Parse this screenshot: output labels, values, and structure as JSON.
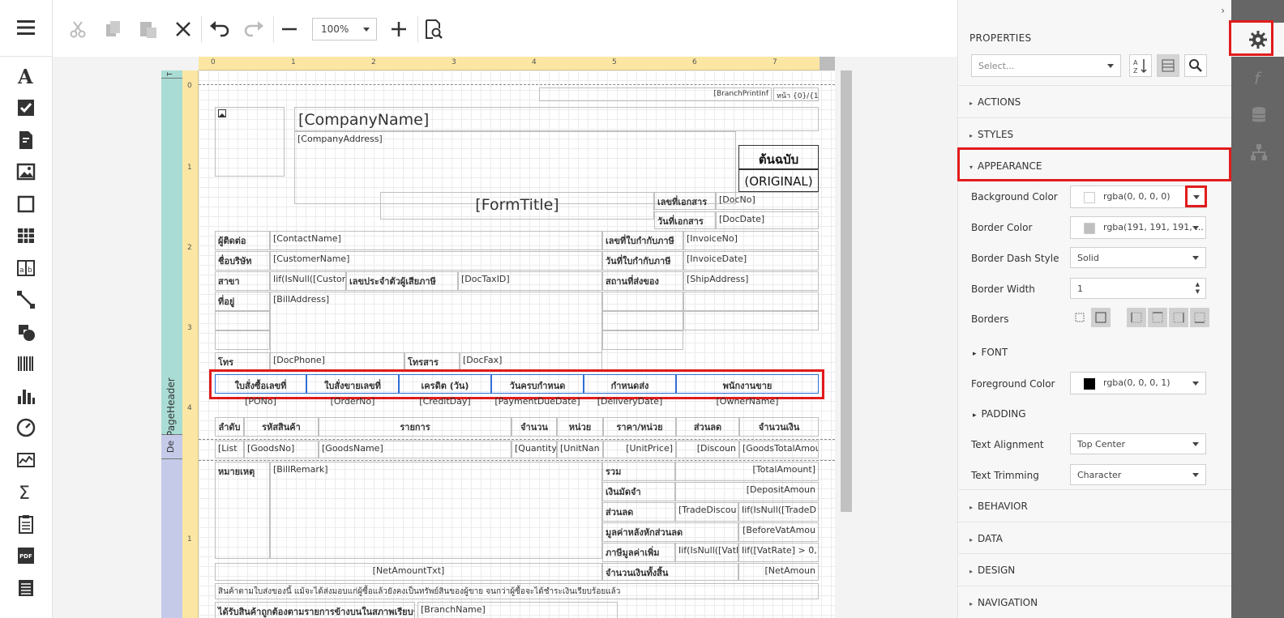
{
  "toolbox": {
    "items": [
      "menu-icon",
      "label-icon",
      "checkbox-icon",
      "rich-text-icon",
      "picture-icon",
      "panel-icon",
      "table-icon",
      "character-comb-icon",
      "line-icon",
      "shape-icon",
      "barcode-icon",
      "chart-icon",
      "gauge-icon",
      "sparkline-icon",
      "summary-icon",
      "page-info-icon",
      "pdf-icon",
      "table-of-contents-icon"
    ]
  },
  "toolbar": {
    "zoom": "100%"
  },
  "ruler": {
    "top_numbers": [
      "0",
      "1",
      "2",
      "3",
      "4",
      "5",
      "6",
      "7"
    ],
    "left_numbers": [
      "0",
      "1",
      "2",
      "3",
      "4",
      "1"
    ]
  },
  "bands": {
    "top_band_label": "T",
    "page_header_label": "PageHeader",
    "detail_label": "De"
  },
  "report": {
    "branch_print": "[BranchPrintInf",
    "page_number": "หน้า {0}/{1}",
    "company_name": "[CompanyName]",
    "company_address": "[CompanyAddress]",
    "original_th": "ต้นฉบับ",
    "original_en": "(ORIGINAL)",
    "form_title": "[FormTitle]",
    "doc_no_label": "เลขที่เอกสาร",
    "doc_no": "[DocNo]",
    "doc_date_label": "วันที่เอกสาร",
    "doc_date": "[DocDate]",
    "contact_label": "ผู้ติดต่อ",
    "contact": "[ContactName]",
    "invoice_no_label": "เลขที่ใบกำกับภาษี",
    "invoice_no": "[InvoiceNo]",
    "customer_label": "ชื่อบริษัท",
    "customer": "[CustomerName]",
    "invoice_date_label": "วันที่ใบกำกับภาษี",
    "invoice_date": "[InvoiceDate]",
    "branch_label": "สาขา",
    "branch_expr": "Iif(IsNull([Custon",
    "taxid_label": "เลขประจำตัวผู้เสียภาษี",
    "taxid": "[DocTaxID]",
    "ship_label": "สถานที่ส่งของ",
    "ship": "[ShipAddress]",
    "address_label": "ที่อยู่",
    "address": "[BillAddress]",
    "phone_label": "โทร",
    "phone": "[DocPhone]",
    "fax_label": "โทรสาร",
    "fax": "[DocFax]",
    "header_row": [
      "ใบสั่งซื้อเลขที่",
      "ใบสั่งขายเลขที่",
      "เครดิต (วัน)",
      "วันครบกำหนด",
      "กำหนดส่ง",
      "พนักงานขาย"
    ],
    "header_values": [
      "[PONo]",
      "[OrderNo]",
      "[CreditDay]",
      "[PaymentDueDate]",
      "[DeliveryDate]",
      "[OwnerName]"
    ],
    "col_headers": [
      "ลำดับ",
      "รหัสสินค้า",
      "รายการ",
      "จำนวน",
      "หน่วย",
      "ราคา/หน่วย",
      "ส่วนลด",
      "จำนวนเงิน"
    ],
    "detail_row": [
      "[List",
      "[GoodsNo]",
      "[GoodsName]",
      "[Quantity",
      "[UnitNan",
      "[UnitPrice]",
      "[Discoun",
      "[GoodsTotalAmou"
    ],
    "remark_label": "หมายเหตุ",
    "remark": "[BillRemark]",
    "total_label": "รวม",
    "total": "[TotalAmount]",
    "deposit_label": "เงินมัดจำ",
    "deposit": "[DepositAmoun",
    "discount_label": "ส่วนลด",
    "discount_text": "[TradeDiscou",
    "discount_expr": "Iif(IsNull([TradeD",
    "before_vat_label": "มูลค่าหลังหักส่วนลด",
    "before_vat": "[BeforeVatAmou",
    "vat_label": "ภาษีมูลค่าเพิ่ม",
    "vat_expr1": "Iif(IsNull([Vatl",
    "vat_expr2": "Iif([VatRate] > 0,",
    "net_text": "[NetAmountTxt]",
    "net_label": "จำนวนเงินทั้งสิ้น",
    "net": "[NetAmoun",
    "footer_note": "สินค้าตามใบส่งของนี้ แม้จะได้ส่งมอบแก่ผู้ซื้อแล้วยังคงเป็นทรัพย์สินของผู้ขาย จนกว่าผู้ซื้อจะได้ชำระเงินเรียบร้อยแล้ว",
    "footer_cut1": "ได้รับสินค้าถูกต้องตามรายการข้างบนในสภาพเรียบร้อย",
    "footer_cut2": "[BranchName]"
  },
  "properties": {
    "title": "PROPERTIES",
    "select_placeholder": "Select...",
    "sections_top": [
      "ACTIONS",
      "STYLES"
    ],
    "appearance": "APPEARANCE",
    "background_color_label": "Background Color",
    "background_color": "rgba(0, 0, 0, 0)",
    "border_color_label": "Border Color",
    "border_color": "rgba(191, 191, 191, ...",
    "border_dash_label": "Border Dash Style",
    "border_dash": "Solid",
    "border_width_label": "Border Width",
    "border_width": "1",
    "borders_label": "Borders",
    "font_label": "FONT",
    "foreground_color_label": "Foreground Color",
    "foreground_color": "rgba(0, 0, 0, 1)",
    "padding_label": "PADDING",
    "text_alignment_label": "Text Alignment",
    "text_alignment": "Top Center",
    "text_trimming_label": "Text Trimming",
    "text_trimming": "Character",
    "sections_bottom": [
      "BEHAVIOR",
      "DATA",
      "DESIGN",
      "NAVIGATION"
    ]
  },
  "colors": {
    "highlight": "#e21b1b",
    "selection": "#2f6fd6",
    "ruler": "#fbe7a3",
    "band_top": "#a8dcd4",
    "band_detail": "#c5cae9"
  },
  "side_tabs": [
    "gear-icon",
    "function-icon",
    "database-icon",
    "tree-icon"
  ]
}
